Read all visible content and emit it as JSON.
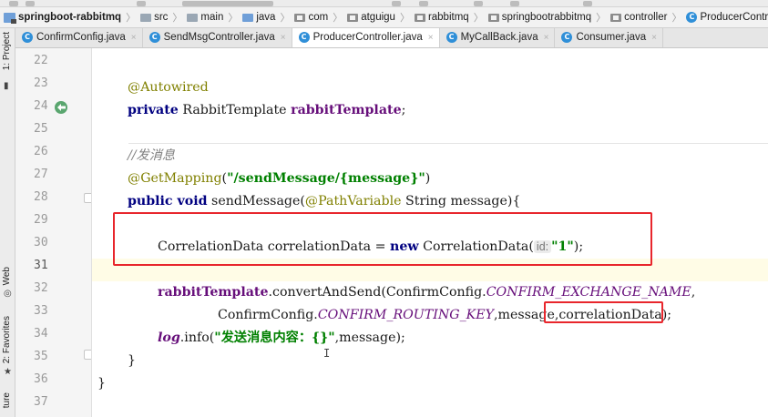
{
  "breadcrumb": [
    {
      "label": "springboot-rabbitmq",
      "icon": "project-folder-icon"
    },
    {
      "label": "src",
      "icon": "folder-icon"
    },
    {
      "label": "main",
      "icon": "folder-icon"
    },
    {
      "label": "java",
      "icon": "source-folder-icon"
    },
    {
      "label": "com",
      "icon": "package-icon"
    },
    {
      "label": "atguigu",
      "icon": "package-icon"
    },
    {
      "label": "rabbitmq",
      "icon": "package-icon"
    },
    {
      "label": "springbootrabbitmq",
      "icon": "package-icon"
    },
    {
      "label": "controller",
      "icon": "package-icon"
    },
    {
      "label": "ProducerControlle",
      "icon": "class-icon"
    }
  ],
  "tool_windows": {
    "project": "1: Project",
    "web": "Web",
    "favorites": "2: Favorites",
    "structure": "ture"
  },
  "tabs": [
    {
      "label": "ConfirmConfig.java",
      "active": false
    },
    {
      "label": "SendMsgController.java",
      "active": false
    },
    {
      "label": "ProducerController.java",
      "active": true
    },
    {
      "label": "MyCallBack.java",
      "active": false
    },
    {
      "label": "Consumer.java",
      "active": false
    }
  ],
  "class_icon_letter": "C",
  "close_glyph": "×",
  "line_numbers": [
    "22",
    "23",
    "24",
    "25",
    "26",
    "27",
    "28",
    "29",
    "30",
    "31",
    "32",
    "33",
    "34",
    "35",
    "36",
    "37"
  ],
  "current_line": "31",
  "code": {
    "l23_anno": "@Autowired",
    "l24_kw": "private",
    "l24_type": " RabbitTemplate ",
    "l24_field": "rabbitTemplate",
    "l24_end": ";",
    "l26_comment": "//发消息",
    "l27_anno": "@GetMapping",
    "l27_open": "(",
    "l27_str": "\"/sendMessage/{message}\"",
    "l27_close": ")",
    "l28_kw1": "public",
    "l28_kw2": " void",
    "l28_name": " sendMessage(",
    "l28_anno": "@PathVariable",
    "l28_rest": " String message){",
    "l30_decl": "CorrelationData correlationData = ",
    "l30_kw": "new",
    "l30_ctor": " CorrelationData(",
    "l30_hint": "id:",
    "l30_str": "\"1\"",
    "l30_end": ");",
    "l32_field": "rabbitTemplate",
    "l32_call": ".convertAndSend(ConfirmConfig.",
    "l32_const": "CONFIRM_EXCHANGE_NAME",
    "l32_end": ",",
    "l33_class": "ConfirmConfig.",
    "l33_const": "CONFIRM_ROUTING_KEY",
    "l33_args": ",message,",
    "l33_arg": "correlationData",
    "l33_end": ");",
    "l34_log": "log",
    "l34_call": ".info(",
    "l34_str": "\"发送消息内容：{}\"",
    "l34_end": ",message);",
    "l35_brace": "}",
    "l36_brace": "}"
  },
  "mouse_cursor": "I",
  "colors": {
    "annotation": "#808000",
    "keyword": "#000080",
    "field": "#660e7a",
    "string": "#008000",
    "comment": "#808080",
    "highlight_box": "#e8262c",
    "class_icon": "#2f8fd8"
  }
}
